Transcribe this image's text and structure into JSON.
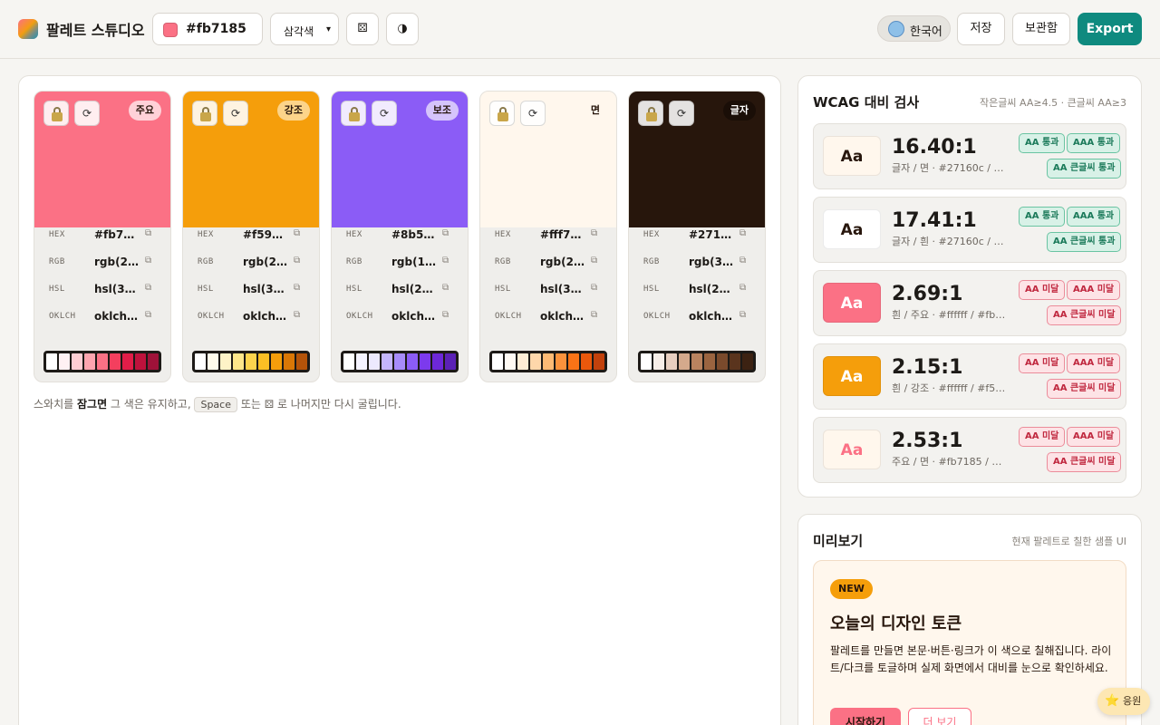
{
  "header": {
    "app_title": "팔레트 스튜디오",
    "base_color": "#fb7185",
    "hex_value": "#fb7185",
    "scheme_value": "삼각색",
    "scheme_caret": "▾",
    "random_icon": "⚄",
    "theme_icon": "◑",
    "language": "한국어",
    "save_label": "저장",
    "library_label": "보관함",
    "export_label": "Export"
  },
  "row_labels": {
    "hex": "HEX",
    "rgb": "RGB",
    "hsl": "HSL",
    "oklch": "OKLCH"
  },
  "copy_icon": "⧉",
  "reroll_icon": "⟳",
  "cards": [
    {
      "role": "주요",
      "color": "#fb7185",
      "hex": "#fb71…",
      "rgb": "rgb(25…",
      "hsl": "hsl(35…",
      "oklch": "oklch(…",
      "badge_bg": "#ffd1d8",
      "badge_fg": "#27160c",
      "shades": [
        "#ffffff",
        "#fff1f3",
        "#fecdd3",
        "#fda4af",
        "#fb7185",
        "#f43f5e",
        "#e11d48",
        "#be123c",
        "#9f1239"
      ]
    },
    {
      "role": "강조",
      "color": "#f59e0b",
      "hex": "#f59e…",
      "rgb": "rgb(24…",
      "hsl": "hsl(38,…",
      "oklch": "oklch(…",
      "badge_bg": "#fcd48a",
      "badge_fg": "#27160c",
      "shades": [
        "#ffffff",
        "#fffbeb",
        "#fef3c7",
        "#fde68a",
        "#fcd34d",
        "#fbbf24",
        "#f59e0b",
        "#d97706",
        "#b45309"
      ]
    },
    {
      "role": "보조",
      "color": "#8b5cf6",
      "hex": "#8b5c…",
      "rgb": "rgb(13…",
      "hsl": "hsl(25…",
      "oklch": "oklch(…",
      "badge_bg": "#d5c4fb",
      "badge_fg": "#27160c",
      "shades": [
        "#ffffff",
        "#f5f3ff",
        "#ede9fe",
        "#c4b5fd",
        "#a78bfa",
        "#8b5cf6",
        "#7c3aed",
        "#6d28d9",
        "#5b21b6"
      ]
    },
    {
      "role": "면",
      "color": "#fff7ed",
      "hex": "#fff7ed",
      "rgb": "rgb(25…",
      "hsl": "hsl(33,…",
      "oklch": "oklch(…",
      "badge_bg": "#fff7ed",
      "badge_fg": "#27160c",
      "shades": [
        "#ffffff",
        "#fffaf3",
        "#ffedd5",
        "#fed7aa",
        "#fdba74",
        "#fb923c",
        "#f97316",
        "#ea580c",
        "#c2410c"
      ]
    },
    {
      "role": "글자",
      "color": "#27160c",
      "hex": "#2716…",
      "rgb": "rgb(39…",
      "hsl": "hsl(22,…",
      "oklch": "oklch(…",
      "badge_bg": "#1a0e07",
      "badge_fg": "#ffffff",
      "shades": [
        "#ffffff",
        "#f7eee8",
        "#e8cfc0",
        "#d4a98c",
        "#b9835f",
        "#9a6440",
        "#7a4a2c",
        "#5a341d",
        "#3c2212"
      ]
    }
  ],
  "hint": {
    "prefix": "스와치를 ",
    "bold": "잠그면",
    "middle": " 그 색은 유지하고, ",
    "key": "Space",
    "suffix": " 또는 ⚄ 로 나머지만 다시 굴립니다."
  },
  "wcag": {
    "title": "WCAG 대비 검사",
    "subtitle": "작은글씨 AA≥4.5 · 큰글씨 AA≥3",
    "sample_text": "Aa",
    "rows": [
      {
        "ratio": "16.40:1",
        "desc": "글자 / 면 · #27160c / #fff7ed",
        "bg": "#fff7ed",
        "fg": "#27160c",
        "chips": [
          "AA 통과",
          "AAA 통과",
          "AA 큰글씨 통과"
        ],
        "pass": true
      },
      {
        "ratio": "17.41:1",
        "desc": "글자 / 흰 · #27160c / #ffffff",
        "bg": "#ffffff",
        "fg": "#27160c",
        "chips": [
          "AA 통과",
          "AAA 통과",
          "AA 큰글씨 통과"
        ],
        "pass": true
      },
      {
        "ratio": "2.69:1",
        "desc": "흰 / 주요 · #ffffff / #fb7185",
        "bg": "#fb7185",
        "fg": "#ffffff",
        "chips": [
          "AA 미달",
          "AAA 미달",
          "AA 큰글씨 미달"
        ],
        "pass": false
      },
      {
        "ratio": "2.15:1",
        "desc": "흰 / 강조 · #ffffff / #f59e0b",
        "bg": "#f59e0b",
        "fg": "#ffffff",
        "chips": [
          "AA 미달",
          "AAA 미달",
          "AA 큰글씨 미달"
        ],
        "pass": false
      },
      {
        "ratio": "2.53:1",
        "desc": "주요 / 면 · #fb7185 / #fff7ed",
        "bg": "#fff7ed",
        "fg": "#fb7185",
        "chips": [
          "AA 미달",
          "AAA 미달",
          "AA 큰글씨 미달"
        ],
        "pass": false
      }
    ]
  },
  "preview": {
    "title": "미리보기",
    "subtitle": "현재 팔레트로 칠한 샘플 UI",
    "badge": "NEW",
    "heading": "오늘의 디자인 토큰",
    "body": "팔레트를 만들면 본문·버튼·링크가 이 색으로 칠해집니다. 라이트/다크를 토글하며 실제 화면에서 대비를 눈으로 확인하세요.",
    "primary_cta": "시작하기",
    "secondary_cta": "더 보기"
  },
  "support": {
    "icon": "⭐",
    "label": "응원"
  }
}
